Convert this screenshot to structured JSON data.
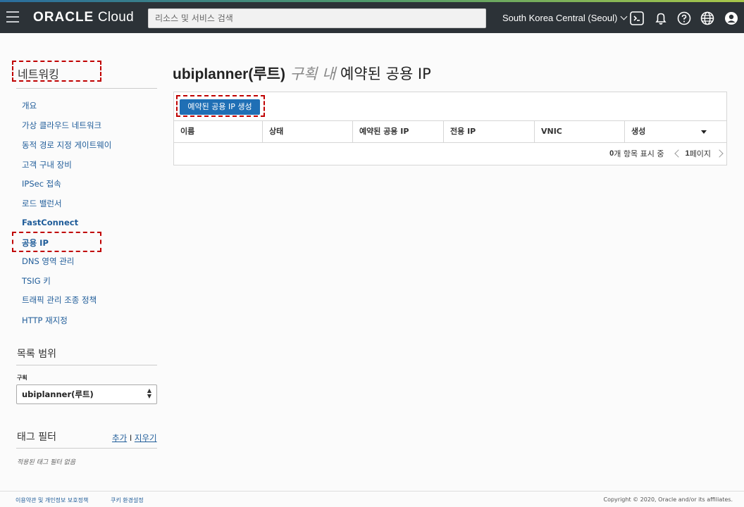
{
  "topbar": {
    "logo_brand": "ORACLE",
    "logo_product": "Cloud",
    "search_placeholder": "리소스 및 서비스 검색",
    "region": "South Korea Central (Seoul)"
  },
  "sidebar": {
    "title": "네트워킹",
    "items": [
      {
        "label": "개요"
      },
      {
        "label": "가상 클라우드 네트워크"
      },
      {
        "label": "동적 경로 지정 게이트웨이"
      },
      {
        "label": "고객 구내 장비"
      },
      {
        "label": "IPSec 접속"
      },
      {
        "label": "로드 밸런서"
      },
      {
        "label": "FastConnect"
      },
      {
        "label": "공용 IP"
      },
      {
        "label": "DNS 영역 관리"
      },
      {
        "label": "TSIG 키"
      },
      {
        "label": "트래픽 관리 조종 정책"
      },
      {
        "label": "HTTP 재지정"
      }
    ],
    "scope_title": "목록 범위",
    "compartment_label": "구획",
    "compartment_value": "ubiplanner(루트)",
    "tag_filter_title": "태그 필터",
    "tag_add": "추가",
    "tag_sep": "I",
    "tag_clear": "지우기",
    "tag_empty": "적용된 태그 필터 없음"
  },
  "main": {
    "title_name": "ubiplanner(루트)",
    "title_in": "구획 내",
    "title_rest": "예약된 공용 IP",
    "create_button": "예약된 공용 IP 생성",
    "columns": [
      "이름",
      "상태",
      "예약된 공용 IP",
      "전용 IP",
      "VNIC",
      "생성"
    ],
    "pager_count": "0",
    "pager_count_suffix": "개 항목 표시 중",
    "pager_page": "1",
    "pager_page_suffix": "페이지"
  },
  "footer": {
    "terms": "이용약관 및 개인정보 보호정책",
    "cookies": "쿠키 환경설정",
    "copyright": "Copyright © 2020, Oracle and/or its affiliates."
  },
  "colors": {
    "topbar": "#2c3237",
    "link": "#1f5c99",
    "button": "#1f6fb5",
    "highlight": "#c00000"
  }
}
